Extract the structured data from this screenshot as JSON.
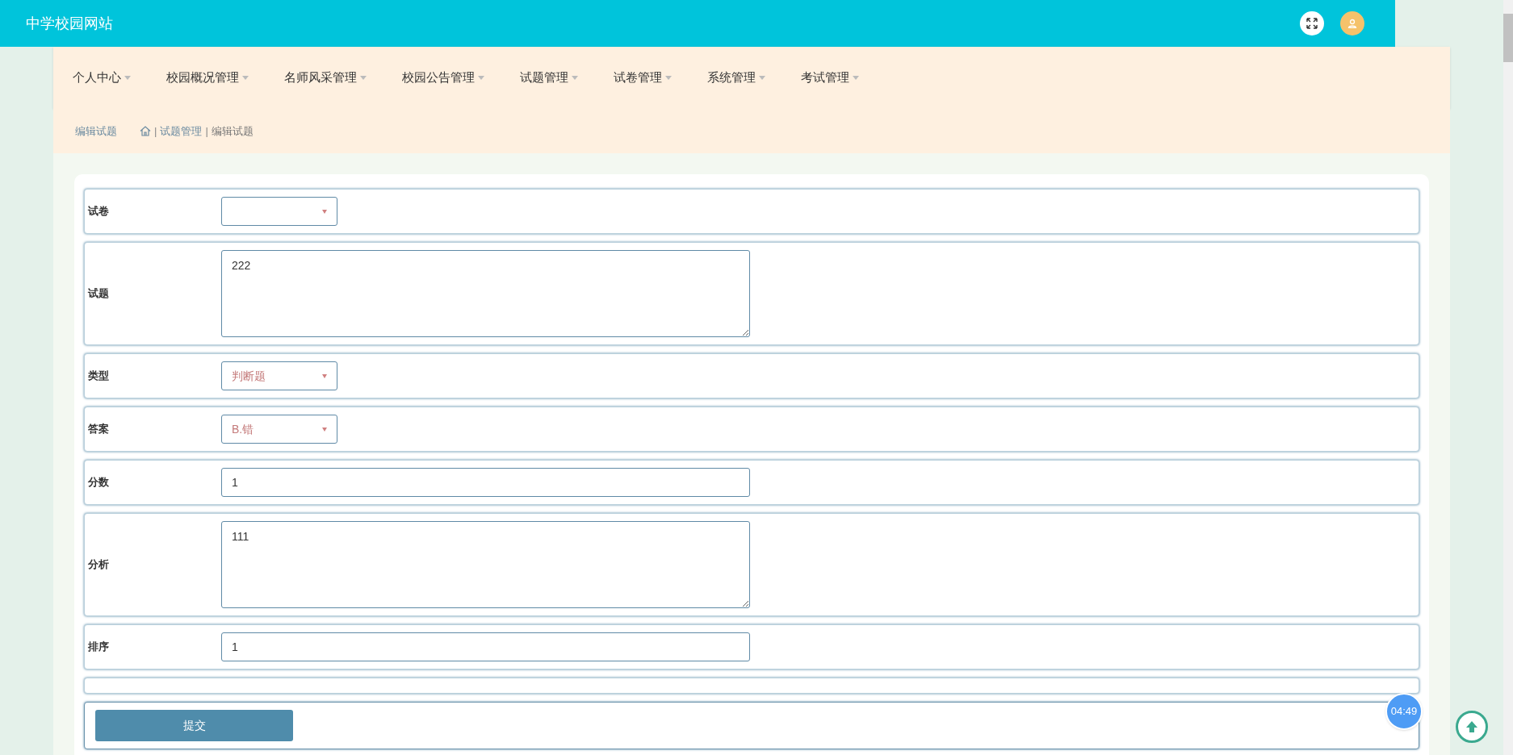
{
  "header": {
    "title": "中学校园网站"
  },
  "nav": [
    {
      "label": "个人中心"
    },
    {
      "label": "校园概况管理"
    },
    {
      "label": "名师风采管理"
    },
    {
      "label": "校园公告管理"
    },
    {
      "label": "试题管理"
    },
    {
      "label": "试卷管理"
    },
    {
      "label": "系统管理"
    },
    {
      "label": "考试管理"
    }
  ],
  "breadcrumb": {
    "title": "编辑试题",
    "separator": "|",
    "path": [
      "试题管理",
      "编辑试题"
    ]
  },
  "form": {
    "fields": [
      {
        "label": "试卷",
        "kind": "select"
      },
      {
        "label": "试题",
        "kind": "textarea",
        "value": "222"
      },
      {
        "label": "类型",
        "kind": "select",
        "value": "判断题"
      },
      {
        "label": "答案",
        "kind": "select",
        "value": "B.错"
      },
      {
        "label": "分数",
        "kind": "input",
        "value": "1"
      },
      {
        "label": "分析",
        "kind": "textarea",
        "value": "111"
      },
      {
        "label": "排序",
        "kind": "input",
        "value": "1"
      },
      {
        "kind": "empty"
      }
    ],
    "submit": "提交"
  },
  "timer": "04:49"
}
